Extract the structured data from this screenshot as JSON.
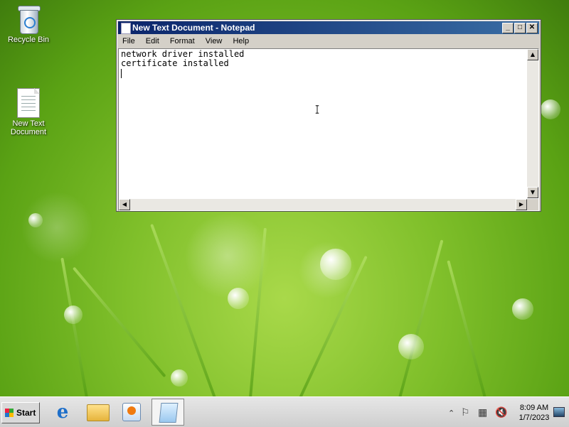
{
  "desktop": {
    "icons": [
      {
        "label": "Recycle Bin"
      },
      {
        "label": "New Text Document"
      }
    ]
  },
  "notepad": {
    "title": "New Text Document - Notepad",
    "menu": [
      "File",
      "Edit",
      "Format",
      "View",
      "Help"
    ],
    "content_line1": "network driver installed",
    "content_line2": "certificate installed",
    "titlebar_buttons": {
      "minimize": "_",
      "maximize": "□",
      "close": "✕"
    }
  },
  "taskbar": {
    "start_label": "Start",
    "pinned": [
      "internet-explorer-icon",
      "windows-explorer-icon",
      "media-player-icon",
      "notepad-icon"
    ],
    "clock_time": "8:09 AM",
    "clock_date": "1/7/2023"
  },
  "colors": {
    "titlebar_start": "#0a246a",
    "titlebar_end": "#3a6ea5",
    "window_face": "#d4d0c8"
  }
}
